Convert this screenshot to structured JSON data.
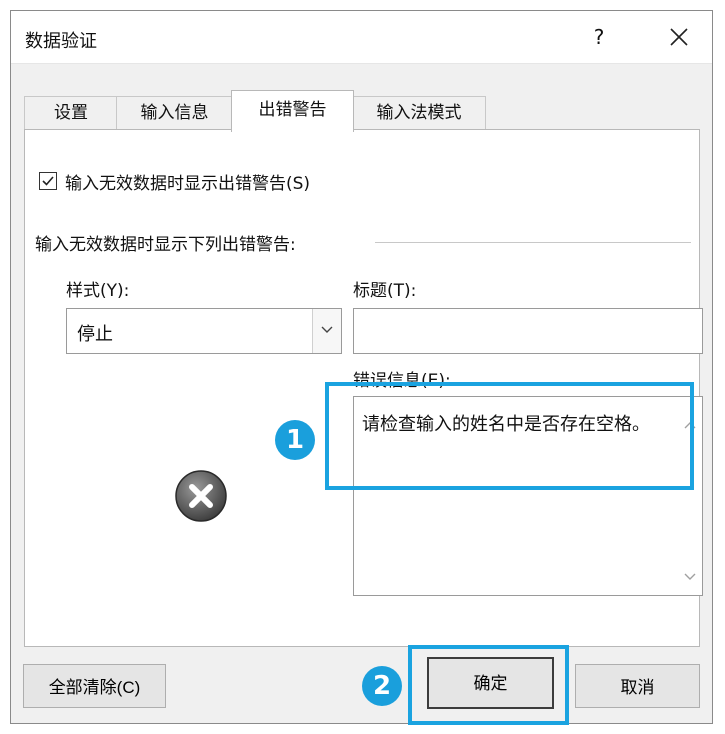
{
  "dialog": {
    "title": "数据验证",
    "help_label": "?"
  },
  "tabs": [
    {
      "label": "设置"
    },
    {
      "label": "输入信息"
    },
    {
      "label": "出错警告",
      "active": true
    },
    {
      "label": "输入法模式"
    }
  ],
  "panel": {
    "show_error_checkbox_label": "输入无效数据时显示出错警告(S)",
    "show_error_checked": true,
    "section_label": "输入无效数据时显示下列出错警告:",
    "style_label": "样式(Y):",
    "style_value": "停止",
    "title_label": "标题(T):",
    "title_value": "",
    "error_message_label": "错误信息(E):",
    "error_message": "请检查输入的姓名中是否存在空格。",
    "style_icon": "stop-error-icon"
  },
  "buttons": {
    "clear_all": "全部清除(C)",
    "ok": "确定",
    "cancel": "取消"
  },
  "callouts": [
    {
      "label": "1"
    },
    {
      "label": "2"
    }
  ],
  "colors": {
    "callout": "#1a9fdc",
    "highlight": "#1aa3e0"
  }
}
